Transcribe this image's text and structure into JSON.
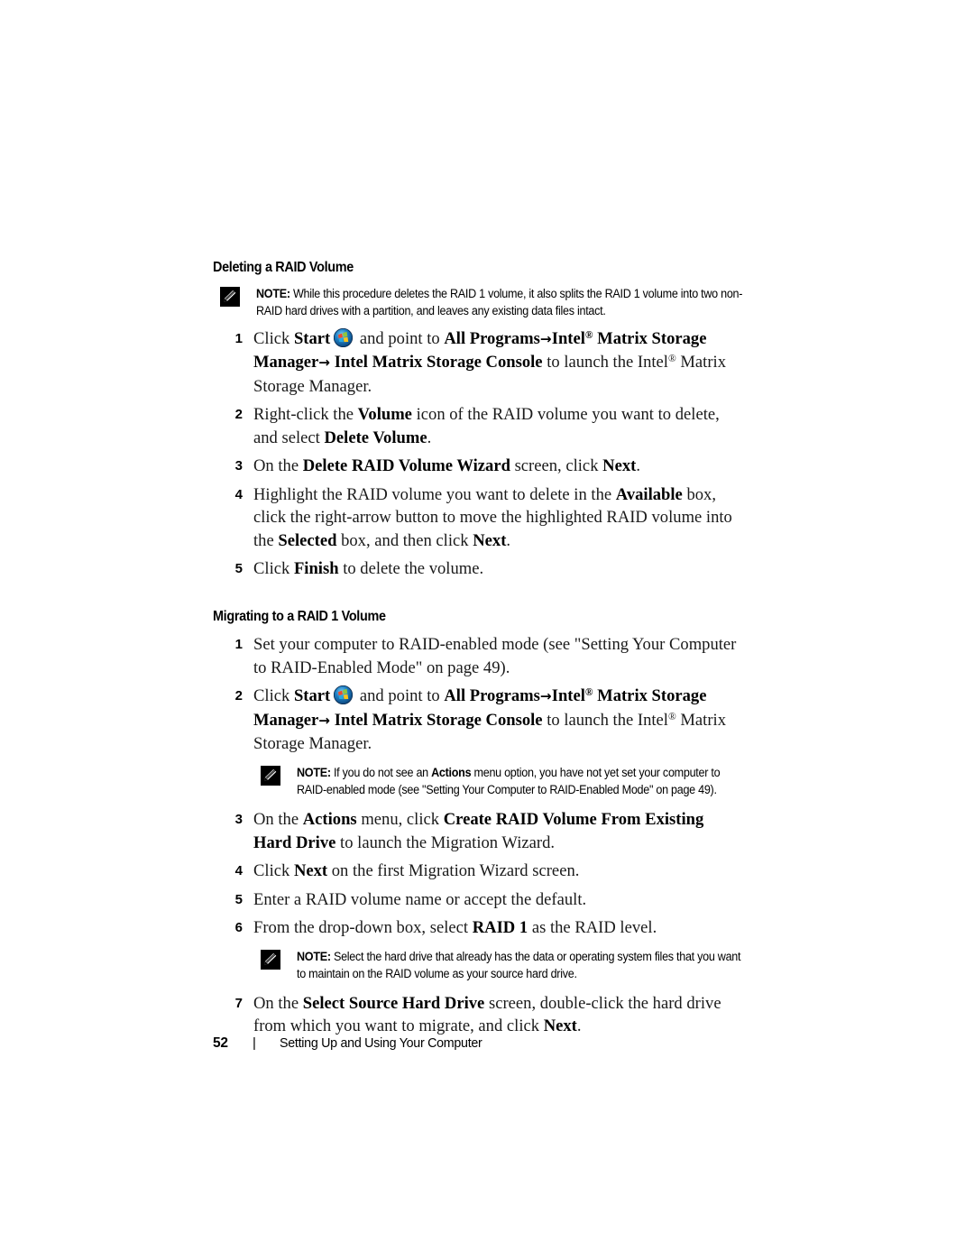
{
  "document": {
    "type": "printed-manual-page",
    "page_number": "52",
    "footer_separator": "|",
    "footer_chapter": "Setting Up and Using Your Computer"
  },
  "sections": [
    {
      "heading": "Deleting a RAID Volume",
      "intro_note": {
        "icon": "note-pencil-icon",
        "label": "NOTE:",
        "text": "While this procedure deletes the RAID 1 volume, it also splits the RAID 1 volume into two non-RAID hard drives with a partition, and leaves any existing data files intact."
      },
      "steps": [
        {
          "num": "1",
          "text": "Click Start  and point to All Programs→ Intel® Matrix Storage Manager→ Intel Matrix Storage Console to launch the Intel® Matrix Storage Manager."
        },
        {
          "num": "2",
          "text": "Right-click the Volume icon of the RAID volume you want to delete, and select Delete Volume."
        },
        {
          "num": "3",
          "text": "On the Delete RAID Volume Wizard screen, click Next."
        },
        {
          "num": "4",
          "text": "Highlight the RAID volume you want to delete in the Available box, click the right-arrow button to move the highlighted RAID volume into the Selected box, and then click Next."
        },
        {
          "num": "5",
          "text": "Click Finish to delete the volume."
        }
      ]
    },
    {
      "heading": "Migrating to a RAID 1 Volume",
      "steps": [
        {
          "num": "1",
          "text": "Set your computer to RAID-enabled mode (see \"Setting Your Computer to RAID-Enabled Mode\" on page 49)."
        },
        {
          "num": "2",
          "text": "Click Start  and point to All Programs→ Intel® Matrix Storage Manager→ Intel Matrix Storage Console to launch the Intel® Matrix Storage Manager."
        },
        {
          "num": "3",
          "text": "On the Actions menu, click Create RAID Volume From Existing Hard Drive to launch the Migration Wizard."
        },
        {
          "num": "4",
          "text": "Click Next on the first Migration Wizard screen."
        },
        {
          "num": "5",
          "text": "Enter a RAID volume name or accept the default."
        },
        {
          "num": "6",
          "text": "From the drop-down box, select RAID 1 as the RAID level."
        },
        {
          "num": "7",
          "text": "On the Select Source Hard Drive screen, double-click the hard drive from which you want to migrate, and click Next."
        }
      ],
      "note_after_step2": {
        "icon": "note-pencil-icon",
        "label": "NOTE:",
        "text": "If you do not see an Actions menu option, you have not yet set your computer to RAID-enabled mode (see \"Setting Your Computer to RAID-Enabled Mode\" on page 49)."
      },
      "note_after_step6": {
        "icon": "note-pencil-icon",
        "label": "NOTE:",
        "text": "Select the hard drive that already has the data or operating system files that you want to maintain on the RAID volume as your source hard drive."
      }
    }
  ],
  "inline": {
    "start_label": "Start",
    "start_orb_icon": "windows-start-orb-icon",
    "registered_mark": "®",
    "arrow": "→"
  },
  "rich": {
    "s1_heading": "Deleting a RAID Volume",
    "s1_note_label": "NOTE:",
    "s1_note_a": "While this procedure deletes the RAID 1 volume, it also splits the RAID 1 volume into two non-RAID hard drives with a partition, and leaves any existing data files intact.",
    "s1_1_a": "Click ",
    "s1_1_b": "Start",
    "s1_1_c": " and point to ",
    "s1_1_d": "All Programs",
    "s1_1_e": "Intel",
    "s1_1_f": " Matrix Storage Manager",
    "s1_1_g": " Intel Matrix Storage Console",
    "s1_1_h": " to launch the Intel",
    "s1_1_i": " Matrix Storage Manager.",
    "s1_2_a": "Right-click the ",
    "s1_2_b": "Volume",
    "s1_2_c": " icon of the RAID volume you want to delete, and select ",
    "s1_2_d": "Delete Volume",
    "s1_2_e": ".",
    "s1_3_a": "On the ",
    "s1_3_b": "Delete RAID Volume Wizard",
    "s1_3_c": " screen, click ",
    "s1_3_d": "Next",
    "s1_3_e": ".",
    "s1_4_a": "Highlight the RAID volume you want to delete in the ",
    "s1_4_b": "Available",
    "s1_4_c": " box, click the right-arrow button to move the highlighted RAID volume into the ",
    "s1_4_d": "Selected",
    "s1_4_e": " box, and then click ",
    "s1_4_f": "Next",
    "s1_4_g": ".",
    "s1_5_a": "Click ",
    "s1_5_b": "Finish",
    "s1_5_c": " to delete the volume.",
    "s2_heading": "Migrating to a RAID 1 Volume",
    "s2_1_a": "Set your computer to RAID-enabled mode (see \"Setting Your Computer to RAID-Enabled Mode\" on page 49).",
    "s2_2_a": "Click ",
    "s2_2_b": "Start",
    "s2_2_c": " and point to ",
    "s2_2_d": "All Programs",
    "s2_2_e": "Intel",
    "s2_2_f": " Matrix Storage Manager",
    "s2_2_g": " Intel Matrix Storage Console",
    "s2_2_h": " to launch the Intel",
    "s2_2_i": " Matrix Storage Manager.",
    "s2_note1_label": "NOTE:",
    "s2_note1_a": "If you do not see an ",
    "s2_note1_b": "Actions",
    "s2_note1_c": " menu option, you have not yet set your computer to RAID-enabled mode (see \"Setting Your Computer to RAID-Enabled Mode\" on page 49).",
    "s2_3_a": "On the ",
    "s2_3_b": "Actions",
    "s2_3_c": " menu, click ",
    "s2_3_d": "Create RAID Volume From Existing Hard Drive",
    "s2_3_e": " to launch the Migration Wizard.",
    "s2_4_a": "Click ",
    "s2_4_b": "Next",
    "s2_4_c": " on the first Migration Wizard screen.",
    "s2_5_a": "Enter a RAID volume name or accept the default.",
    "s2_6_a": "From the drop-down box, select ",
    "s2_6_b": "RAID 1",
    "s2_6_c": " as the RAID level.",
    "s2_note2_label": "NOTE:",
    "s2_note2_a": "Select the hard drive that already has the data or operating system files that you want to maintain on the RAID volume as your source hard drive.",
    "s2_7_a": "On the ",
    "s2_7_b": "Select Source Hard Drive",
    "s2_7_c": " screen, double-click the hard drive from which you want to migrate, and click ",
    "s2_7_d": "Next",
    "s2_7_e": ".",
    "num1": "1",
    "num2": "2",
    "num3": "3",
    "num4": "4",
    "num5": "5",
    "num6": "6",
    "num7": "7",
    "reg": "®",
    "arrow": "→",
    "page_number": "52",
    "footer_sep": "|",
    "footer_chapter": "Setting Up and Using Your Computer"
  }
}
